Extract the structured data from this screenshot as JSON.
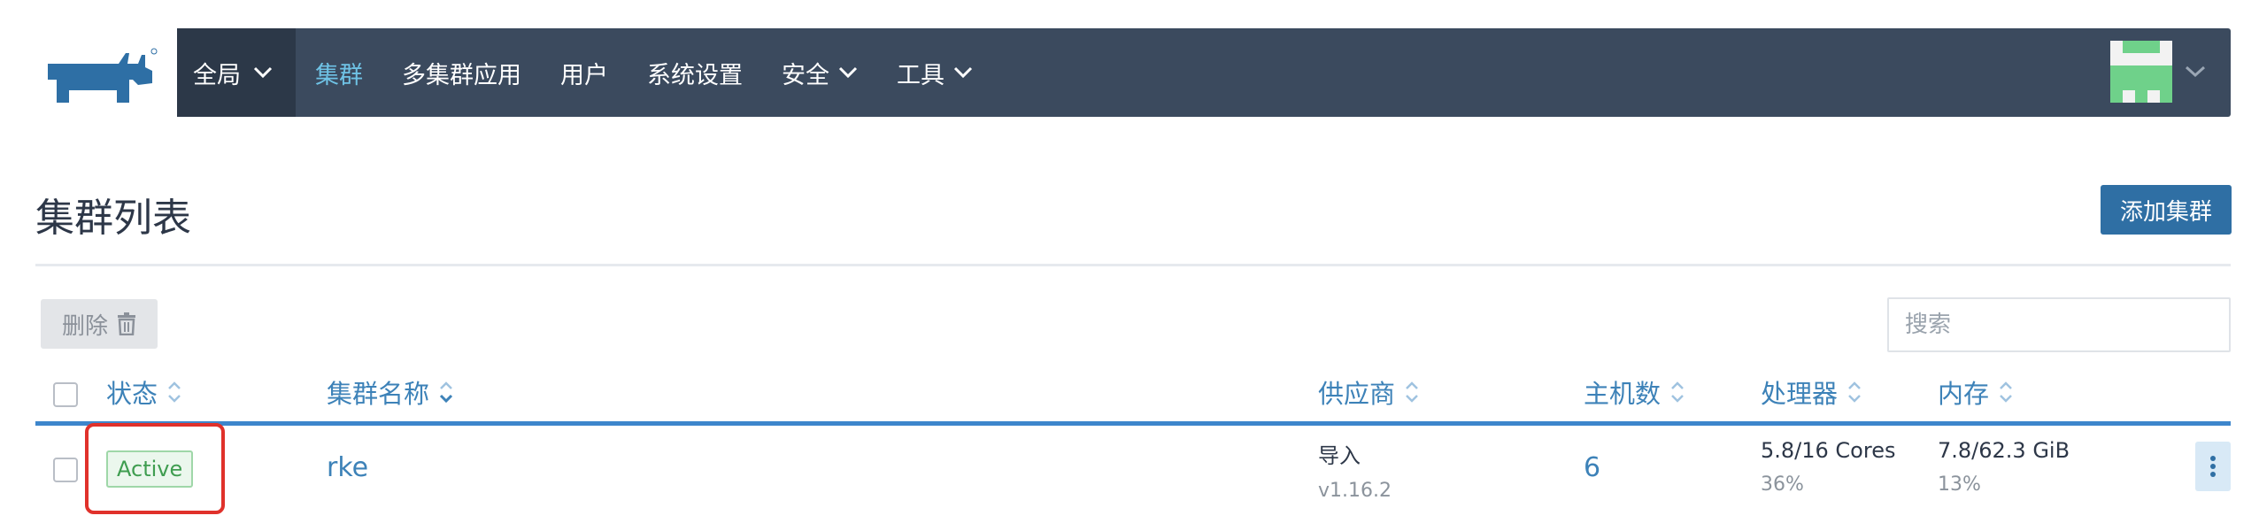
{
  "brand": {
    "logo_icon": "rancher-cow-logo-icon",
    "color": "#2e6fa5"
  },
  "nav": {
    "global_label": "全局",
    "items": [
      {
        "label": "集群",
        "active": true
      },
      {
        "label": "多集群应用",
        "active": false
      },
      {
        "label": "用户",
        "active": false
      },
      {
        "label": "系统设置",
        "active": false
      },
      {
        "label": "安全",
        "active": false,
        "dropdown": true
      },
      {
        "label": "工具",
        "active": false,
        "dropdown": true
      }
    ],
    "bg_color": "#3b4a5e",
    "active_color": "#6fc3e6"
  },
  "page": {
    "title": "集群列表",
    "add_button": "添加集群"
  },
  "toolbar": {
    "delete_label": "删除",
    "search_placeholder": "搜索"
  },
  "table": {
    "columns": [
      "状态",
      "集群名称",
      "供应商",
      "主机数",
      "处理器",
      "内存"
    ],
    "rows": [
      {
        "status": "Active",
        "name": "rke",
        "provider": "导入",
        "provider_version": "v1.16.2",
        "nodes": "6",
        "cpu": "5.8/16 Cores",
        "cpu_pct": "36%",
        "memory": "7.8/62.3 GiB",
        "memory_pct": "13%"
      }
    ]
  },
  "colors": {
    "link": "#3d82b8",
    "status_active": "#3f9d50",
    "highlight_box": "#e0312b",
    "primary_button": "#2f6fa4"
  }
}
